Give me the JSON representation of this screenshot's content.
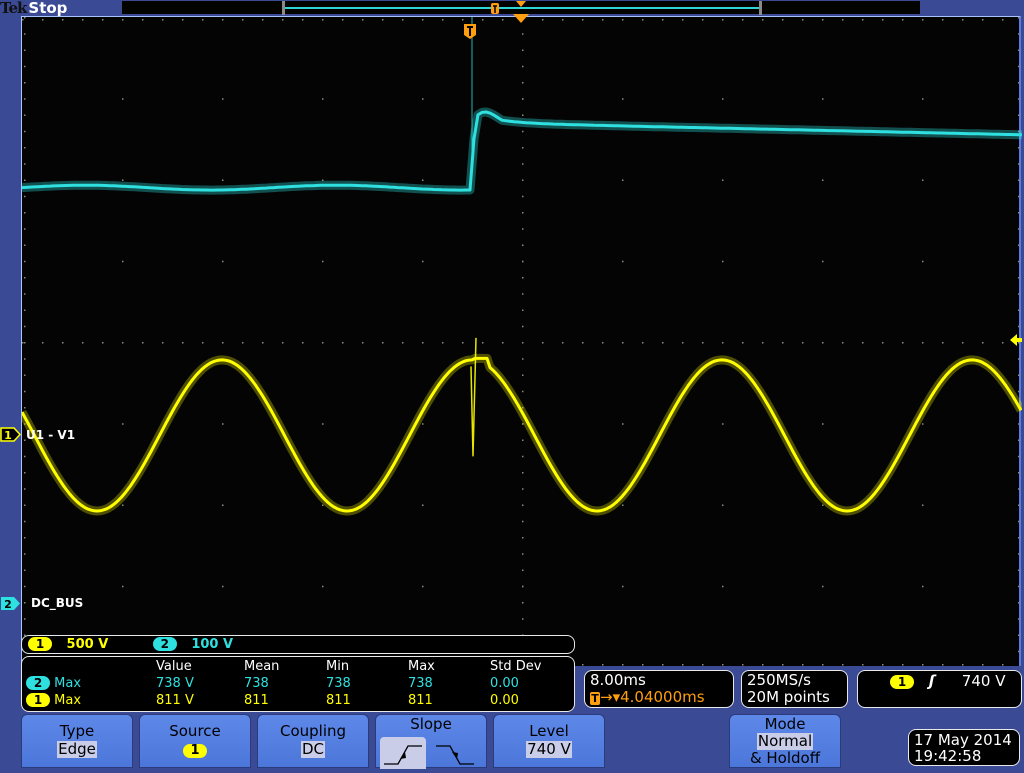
{
  "brand": {
    "vendor": "Tek",
    "run_state": "Stop"
  },
  "channels": [
    {
      "id": "1",
      "label": "U1 - V1",
      "scale": "500 V",
      "color": "#ffff00"
    },
    {
      "id": "2",
      "label": "DC_BUS",
      "scale": "100 V",
      "color": "#2fe0e0"
    }
  ],
  "measurements": {
    "columns": [
      "",
      "Value",
      "Mean",
      "Min",
      "Max",
      "Std Dev"
    ],
    "rows": [
      {
        "channel": "2",
        "name": "Max",
        "value": "738 V",
        "mean": "738",
        "min": "738",
        "max": "738",
        "std_dev": "0.00"
      },
      {
        "channel": "1",
        "name": "Max",
        "value": "811 V",
        "mean": "811",
        "min": "811",
        "max": "811",
        "std_dev": "0.00"
      }
    ]
  },
  "horizontal": {
    "time_per_div": "8.00ms",
    "trigger_position": "4.04000ms",
    "trigger_glyph": "T",
    "arrow": "→▾"
  },
  "acquisition": {
    "sample_rate": "250MS/s",
    "record_length": "20M points"
  },
  "trigger_readout": {
    "source": "1",
    "slope_glyph": "ʃ",
    "level": "740 V"
  },
  "softkeys": [
    {
      "id": "type",
      "header": "Type",
      "value": "Edge"
    },
    {
      "id": "source",
      "header": "Source",
      "value": "1"
    },
    {
      "id": "coupling",
      "header": "Coupling",
      "value": "DC"
    },
    {
      "id": "slope",
      "header": "Slope",
      "options": [
        "rising",
        "falling"
      ],
      "selected": "rising"
    },
    {
      "id": "level",
      "header": "Level",
      "value": "740 V"
    },
    {
      "id": "mode",
      "header": "Mode",
      "value": "Normal",
      "extra": "& Holdoff"
    }
  ],
  "datetime": {
    "date": "17 May 2014",
    "time": "19:42:58"
  },
  "waveforms": {
    "grid": {
      "h_divisions": 10,
      "v_divisions": 8
    },
    "ch1": {
      "type": "sine",
      "amplitude_div": 0.93,
      "offset_div": -1.15,
      "period_div": 2.5,
      "phase_peak_div": 2.0,
      "transient_at_div": 4.5
    },
    "ch2": {
      "pre_level_div": 1.9,
      "post_level_div": 2.7,
      "end_level_div": 2.55,
      "step_at_div": 4.5
    }
  },
  "trigger_marker": {
    "glyph": "T"
  },
  "colors": {
    "ch1": "#ffff00",
    "ch2": "#2fe0e0",
    "trigger": "#ff9f10",
    "background": "#3a4a94",
    "softkey": "#5b86e6"
  }
}
